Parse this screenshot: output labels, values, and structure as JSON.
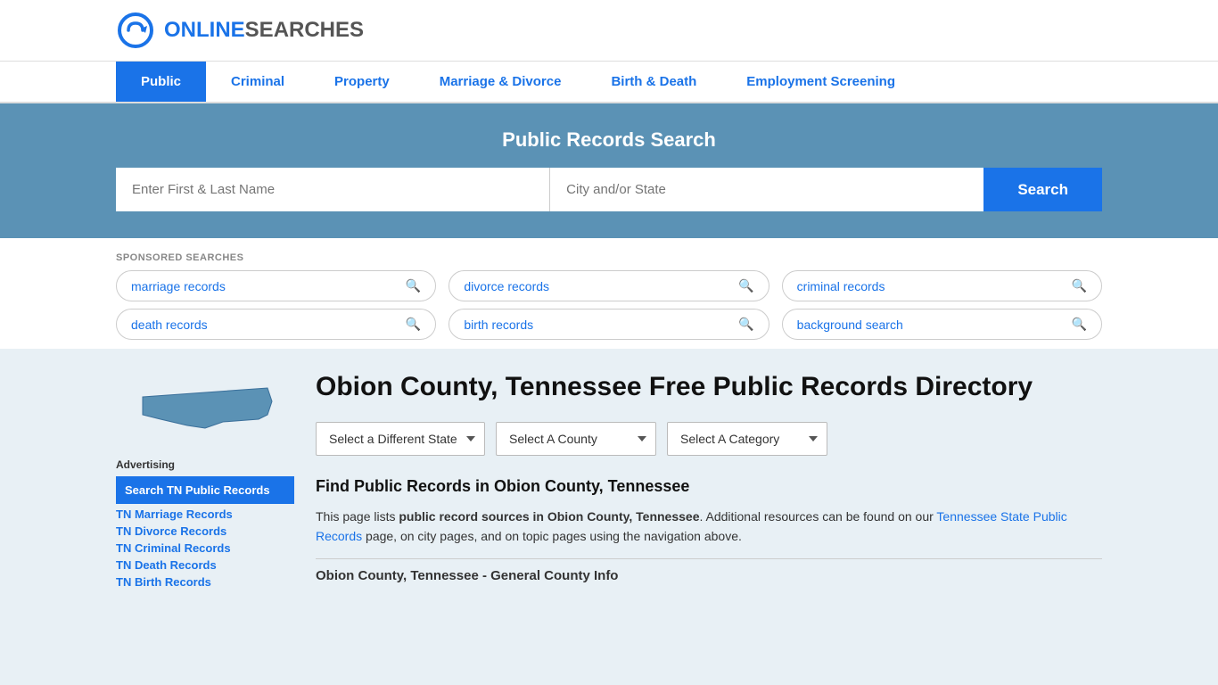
{
  "site": {
    "logo_online": "ONLINE",
    "logo_searches": "SEARCHES"
  },
  "nav": {
    "items": [
      {
        "label": "Public",
        "active": true
      },
      {
        "label": "Criminal",
        "active": false
      },
      {
        "label": "Property",
        "active": false
      },
      {
        "label": "Marriage & Divorce",
        "active": false
      },
      {
        "label": "Birth & Death",
        "active": false
      },
      {
        "label": "Employment Screening",
        "active": false
      }
    ]
  },
  "hero": {
    "title": "Public Records Search",
    "name_placeholder": "Enter First & Last Name",
    "city_placeholder": "City and/or State",
    "search_label": "Search"
  },
  "sponsored": {
    "label": "SPONSORED SEARCHES",
    "pills": [
      {
        "text": "marriage records"
      },
      {
        "text": "divorce records"
      },
      {
        "text": "criminal records"
      },
      {
        "text": "death records"
      },
      {
        "text": "birth records"
      },
      {
        "text": "background search"
      }
    ]
  },
  "page": {
    "title": "Obion County, Tennessee Free Public Records Directory",
    "dropdowns": {
      "state": "Select a Different State",
      "county": "Select A County",
      "category": "Select A Category"
    },
    "section_title": "Find Public Records in Obion County, Tennessee",
    "description_part1": "This page lists ",
    "description_bold": "public record sources in Obion County, Tennessee",
    "description_part2": ". Additional resources can be found on our ",
    "description_link_text": "Tennessee State Public Records",
    "description_part3": " page, on city pages, and on topic pages using the navigation above.",
    "county_info_title": "Obion County, Tennessee - General County Info"
  },
  "sidebar": {
    "ad_label": "Advertising",
    "ad_active": "Search TN Public Records",
    "ad_links": [
      "TN Marriage Records",
      "TN Divorce Records",
      "TN Criminal Records",
      "TN Death Records",
      "TN Birth Records"
    ]
  }
}
